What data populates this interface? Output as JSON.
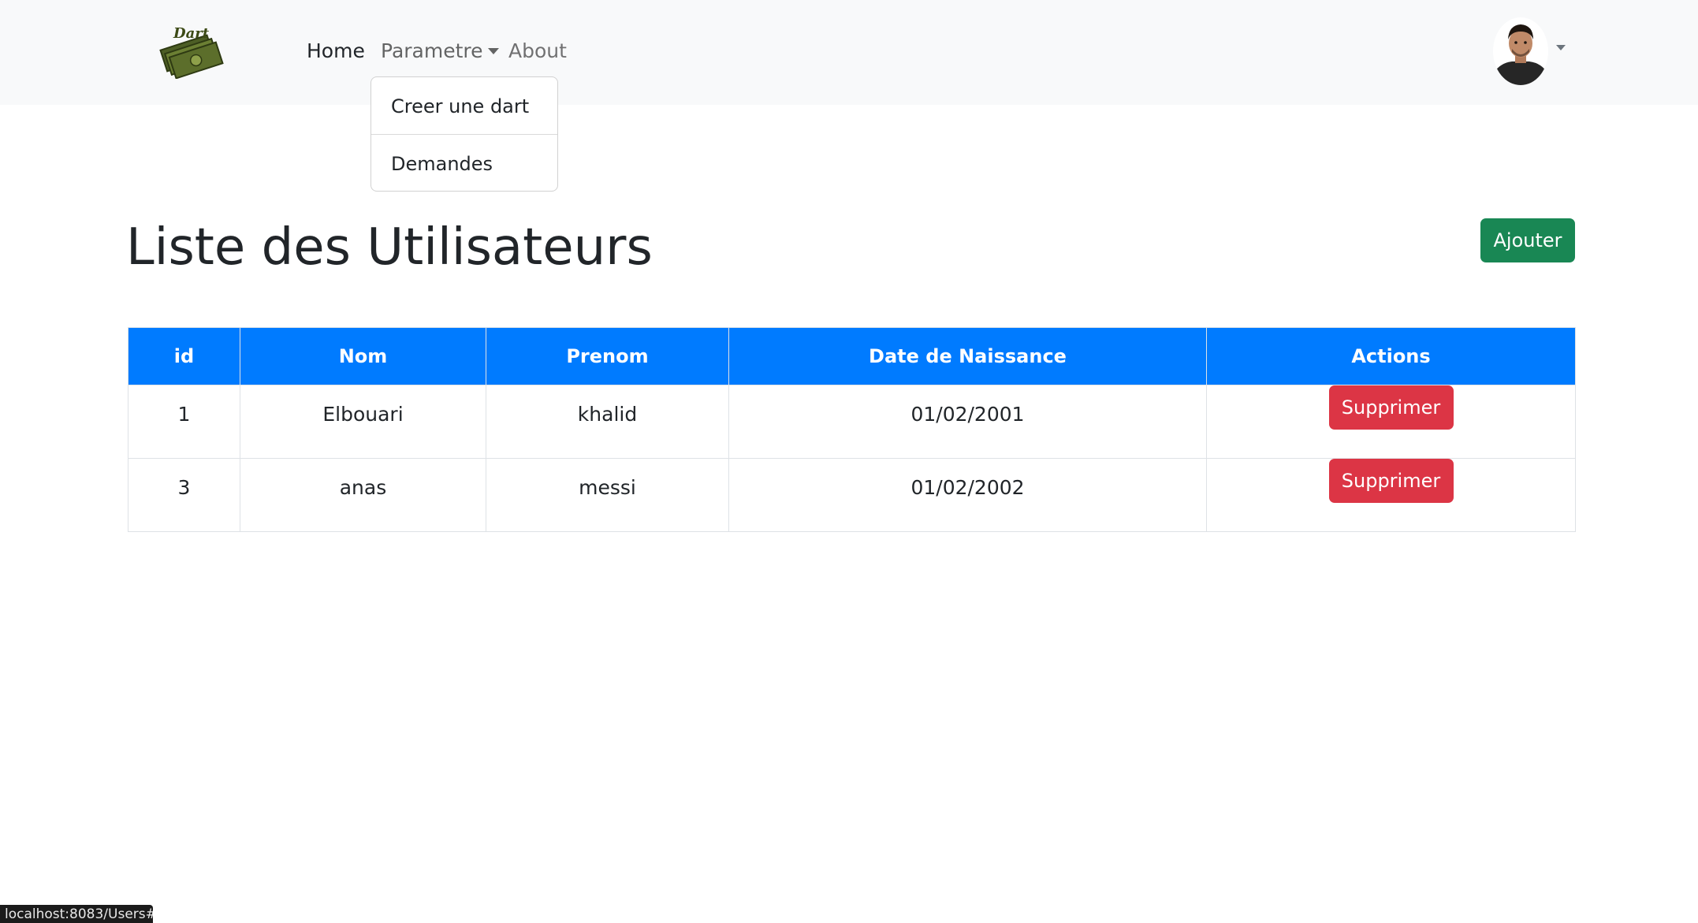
{
  "navbar": {
    "logo_icon": "dart-money-logo-icon",
    "links": {
      "home": "Home",
      "parametre": "Parametre",
      "about": "About"
    },
    "dropdown": {
      "items": [
        "Creer une dart",
        "Demandes"
      ]
    },
    "avatar_icon": "user-avatar-icon"
  },
  "main": {
    "title": "Liste des Utilisateurs",
    "add_button": "Ajouter",
    "table": {
      "headers": [
        "id",
        "Nom",
        "Prenom",
        "Date de Naissance",
        "Actions"
      ],
      "rows": [
        {
          "id": "1",
          "nom": "Elbouari",
          "prenom": "khalid",
          "date": "01/02/2001",
          "action": "Supprimer"
        },
        {
          "id": "3",
          "nom": "anas",
          "prenom": "messi",
          "date": "01/02/2002",
          "action": "Supprimer"
        }
      ]
    }
  },
  "status_bar": {
    "url": "localhost:8083/Users#"
  },
  "colors": {
    "navbar_bg": "#f8f9fa",
    "table_header": "#007bff",
    "add_button": "#198754",
    "delete_button": "#dc3545"
  }
}
